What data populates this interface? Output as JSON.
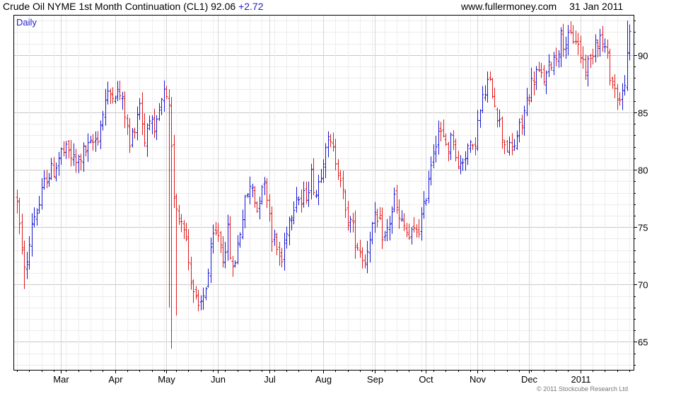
{
  "header": {
    "instrument": "Crude Oil NYME 1st Month Continuation (CL1)",
    "last_price": "92.06",
    "change": "+2.72",
    "website": "www.fullermoney.com",
    "date": "31 Jan 2011"
  },
  "copyright": "© 2011 Stockcube Research Ltd",
  "colors": {
    "up": "#1414d2",
    "down": "#e01818",
    "grid": "#d8d8d8",
    "axis": "#000000",
    "period_label": "#2020c8"
  },
  "chart_data": {
    "type": "ohlc",
    "period_label": "Daily",
    "title": "Crude Oil NYME 1st Month Continuation (CL1)",
    "y_axis_side": "right",
    "ylim": [
      62.5,
      93.5
    ],
    "yticks": [
      65,
      70,
      75,
      80,
      85,
      90
    ],
    "xlim": [
      0,
      250
    ],
    "month_ticks": [
      {
        "label": "Mar",
        "x": 18
      },
      {
        "label": "Apr",
        "x": 40
      },
      {
        "label": "May",
        "x": 61
      },
      {
        "label": "Jun",
        "x": 82
      },
      {
        "label": "Jul",
        "x": 103
      },
      {
        "label": "Aug",
        "x": 125
      },
      {
        "label": "Sep",
        "x": 146
      },
      {
        "label": "Oct",
        "x": 167
      },
      {
        "label": "Nov",
        "x": 188
      },
      {
        "label": "Dec",
        "x": 209
      },
      {
        "label": "2011",
        "x": 230
      }
    ],
    "price_path_anchors": [
      [
        0,
        77.5
      ],
      [
        2,
        72.5
      ],
      [
        4,
        71.5
      ],
      [
        6,
        75.5
      ],
      [
        9,
        77
      ],
      [
        12,
        79.5
      ],
      [
        15,
        80
      ],
      [
        18,
        81.5
      ],
      [
        21,
        81.5
      ],
      [
        24,
        80.5
      ],
      [
        27,
        81.5
      ],
      [
        30,
        82
      ],
      [
        33,
        83
      ],
      [
        36,
        86
      ],
      [
        39,
        87
      ],
      [
        42,
        86.5
      ],
      [
        44,
        85
      ],
      [
        46,
        82
      ],
      [
        48,
        84
      ],
      [
        50,
        86
      ],
      [
        52,
        82.5
      ],
      [
        54,
        85
      ],
      [
        56,
        82.5
      ],
      [
        58,
        85
      ],
      [
        60,
        86.5
      ],
      [
        62,
        85
      ],
      [
        64,
        78
      ],
      [
        66,
        76
      ],
      [
        68,
        75.5
      ],
      [
        70,
        72
      ],
      [
        72,
        69.5
      ],
      [
        74,
        67.5
      ],
      [
        76,
        69
      ],
      [
        78,
        71
      ],
      [
        80,
        74
      ],
      [
        82,
        74.5
      ],
      [
        84,
        72.5
      ],
      [
        86,
        74.5
      ],
      [
        88,
        71
      ],
      [
        90,
        73.5
      ],
      [
        92,
        76
      ],
      [
        94,
        78
      ],
      [
        96,
        78.5
      ],
      [
        98,
        76.5
      ],
      [
        100,
        79
      ],
      [
        102,
        78
      ],
      [
        104,
        74.5
      ],
      [
        106,
        73
      ],
      [
        108,
        72
      ],
      [
        110,
        75
      ],
      [
        112,
        76.5
      ],
      [
        114,
        78
      ],
      [
        116,
        77
      ],
      [
        118,
        78
      ],
      [
        120,
        79.5
      ],
      [
        122,
        78
      ],
      [
        124,
        80
      ],
      [
        126,
        82.5
      ],
      [
        128,
        82
      ],
      [
        130,
        81
      ],
      [
        132,
        79.5
      ],
      [
        134,
        76
      ],
      [
        136,
        75.5
      ],
      [
        138,
        74
      ],
      [
        140,
        73
      ],
      [
        142,
        72
      ],
      [
        144,
        74.5
      ],
      [
        146,
        75.5
      ],
      [
        148,
        75
      ],
      [
        150,
        74
      ],
      [
        152,
        75.5
      ],
      [
        154,
        77.5
      ],
      [
        156,
        75.5
      ],
      [
        158,
        75
      ],
      [
        160,
        74
      ],
      [
        162,
        74.5
      ],
      [
        164,
        75
      ],
      [
        166,
        76.5
      ],
      [
        168,
        79.5
      ],
      [
        170,
        82
      ],
      [
        172,
        83.5
      ],
      [
        174,
        82.5
      ],
      [
        176,
        82
      ],
      [
        178,
        83
      ],
      [
        180,
        80
      ],
      [
        182,
        81
      ],
      [
        184,
        82
      ],
      [
        186,
        81.5
      ],
      [
        188,
        84
      ],
      [
        190,
        86
      ],
      [
        192,
        87.5
      ],
      [
        194,
        87
      ],
      [
        196,
        85
      ],
      [
        198,
        83
      ],
      [
        200,
        82
      ],
      [
        202,
        81.5
      ],
      [
        204,
        83
      ],
      [
        206,
        84
      ],
      [
        208,
        86
      ],
      [
        210,
        87.5
      ],
      [
        212,
        88.5
      ],
      [
        214,
        88
      ],
      [
        216,
        88
      ],
      [
        218,
        89.5
      ],
      [
        220,
        90
      ],
      [
        222,
        91.5
      ],
      [
        224,
        91
      ],
      [
        226,
        91.5
      ],
      [
        228,
        91.5
      ],
      [
        230,
        90
      ],
      [
        232,
        89
      ],
      [
        234,
        89.5
      ],
      [
        236,
        91.5
      ],
      [
        238,
        91.5
      ],
      [
        240,
        90.5
      ],
      [
        242,
        88.5
      ],
      [
        244,
        87
      ],
      [
        246,
        86
      ],
      [
        247,
        86.5
      ],
      [
        249,
        89.5
      ],
      [
        250,
        92.06
      ]
    ]
  }
}
